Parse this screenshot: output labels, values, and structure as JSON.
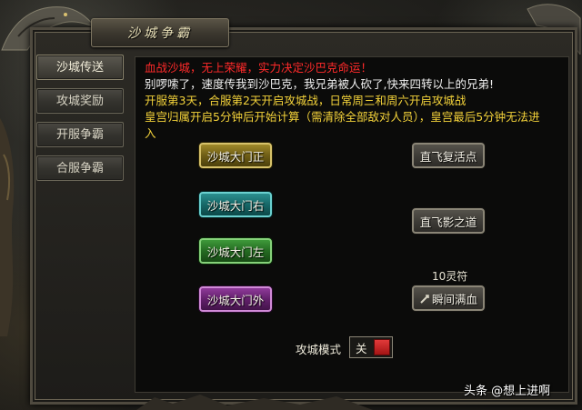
{
  "window": {
    "title": "沙城争霸"
  },
  "sidebar": {
    "tabs": [
      {
        "label": "沙城传送",
        "active": true
      },
      {
        "label": "攻城奖励",
        "active": false
      },
      {
        "label": "开服争霸",
        "active": false
      },
      {
        "label": "合服争霸",
        "active": false
      }
    ]
  },
  "announcement": {
    "line1": "血战沙城，无上荣耀，实力决定沙巴克命运！",
    "line2": "别啰嗦了，速度传我到沙巴克，我兄弟被人砍了,快来四转以上的兄弟!",
    "line3": "开服第3天，合服第2天开启攻城战，日常周三和周六开启攻城战",
    "line4": "皇宫归属开启5分钟后开始计算（需清除全部敌对人员），皇宫最后5分钟无法进",
    "line5": "入"
  },
  "teleport": {
    "gate_main": "沙城大门正",
    "gate_right": "沙城大门右",
    "gate_left": "沙城大门左",
    "gate_outer": "沙城大门外",
    "fly_respawn": "直飞复活点",
    "fly_shadow": "直飞影之道",
    "rune_cost": "10灵符",
    "instant_heal": "瞬间满血"
  },
  "siege_mode": {
    "label": "攻城模式",
    "value": "关"
  },
  "watermark": "头条 @想上进啊",
  "colors": {
    "alert_red": "#ff2a2a",
    "info_yellow": "#f3d23a",
    "toggle_red": "#c42020"
  }
}
